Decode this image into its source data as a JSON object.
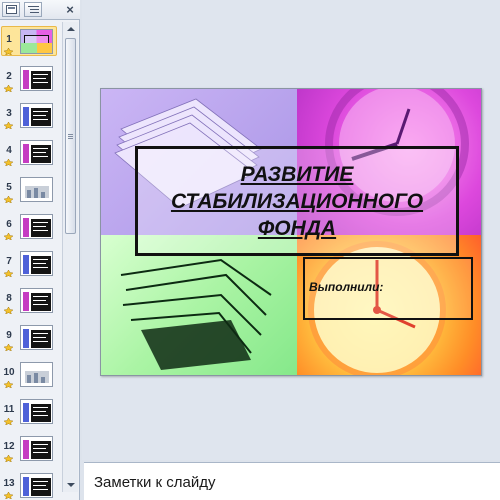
{
  "thumbnail_pane": {
    "tab_slides_icon": "slides-tab-icon",
    "tab_outline_icon": "outline-tab-icon",
    "close_label": "×",
    "slides": [
      {
        "number": "1",
        "selected": true
      },
      {
        "number": "2"
      },
      {
        "number": "3"
      },
      {
        "number": "4"
      },
      {
        "number": "5"
      },
      {
        "number": "6"
      },
      {
        "number": "7"
      },
      {
        "number": "8"
      },
      {
        "number": "9"
      },
      {
        "number": "10"
      },
      {
        "number": "11"
      },
      {
        "number": "12"
      },
      {
        "number": "13"
      }
    ]
  },
  "slide": {
    "title_lines": [
      "РАЗВИТИЕ",
      "СТАБИЛИЗАЦИОННОГО",
      "ФОНДА"
    ],
    "subtitle": "Выполнили:",
    "colors": {
      "top_left": "#b9a4ee",
      "top_right": "#dd48dd",
      "bottom_left": "#aaf4a4",
      "bottom_right": "#ffcb45"
    }
  },
  "notes": {
    "placeholder": "Заметки к слайду"
  }
}
